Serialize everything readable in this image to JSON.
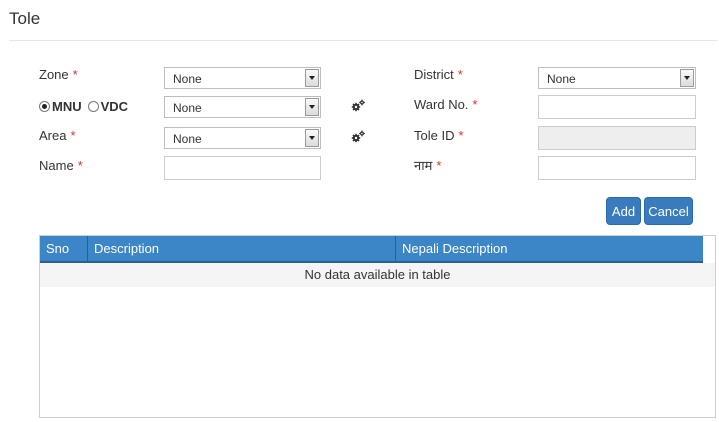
{
  "page": {
    "title": "Tole"
  },
  "form": {
    "zone": {
      "label": "Zone",
      "required": "*",
      "value": "None"
    },
    "district": {
      "label": "District",
      "required": "*",
      "value": "None"
    },
    "type_selector": {
      "option_mnu": "MNU",
      "option_vdc": "VDC",
      "selected": "MNU",
      "value": "None"
    },
    "ward_no": {
      "label": "Ward No.",
      "required": "*",
      "value": ""
    },
    "area": {
      "label": "Area",
      "required": "*",
      "value": "None"
    },
    "tole_id": {
      "label": "Tole ID",
      "required": "*",
      "value": ""
    },
    "name": {
      "label": "Name",
      "required": "*",
      "value": ""
    },
    "nepali_name": {
      "label": "नाम",
      "required": "*",
      "value": ""
    }
  },
  "actions": {
    "add_label": "Add",
    "cancel_label": "Cancel"
  },
  "table": {
    "columns": [
      "Sno",
      "Description",
      "Nepali Description"
    ],
    "empty_message": "No data available in table"
  },
  "colors": {
    "accent": "#3c85c6",
    "button": "#3a7bbd",
    "required": "#d9302c"
  },
  "icons": {
    "settings": "gears-icon"
  }
}
